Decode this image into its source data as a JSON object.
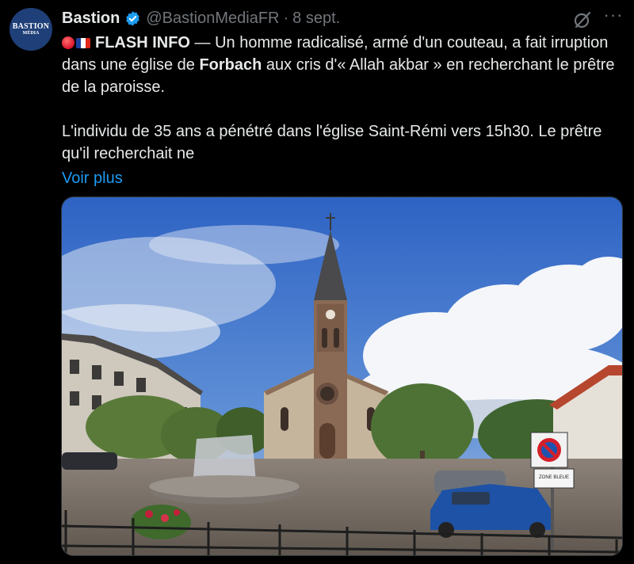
{
  "avatar": {
    "line1": "BASTION",
    "line2": "MÉDIA"
  },
  "author": {
    "name": "Bastion",
    "handle": "@BastionMediaFR",
    "separator": "·",
    "date": "8 sept."
  },
  "icons": {
    "verified": "verified-badge-icon",
    "grok": "grok-icon",
    "more": "more-options-icon"
  },
  "tweet": {
    "flash_label": "FLASH INFO",
    "p1_a": " — Un homme radicalisé, armé d'un couteau, a fait irruption dans une église de ",
    "p1_bold": "Forbach",
    "p1_b": " aux cris d'« Allah akbar » en recherchant le prêtre de la paroisse.",
    "p2": "L'individu de 35 ans a pénétré dans l'église Saint-Rémi vers 15h30. Le prêtre qu'il recherchait ne",
    "more_link": "Voir plus"
  },
  "photo": {
    "sign_text": "ZONE BLEUE"
  },
  "colors": {
    "background": "#000000",
    "text": "#e7e9ea",
    "muted": "#71767b",
    "link": "#1d9bf0",
    "verified": "#1d9bf0"
  }
}
